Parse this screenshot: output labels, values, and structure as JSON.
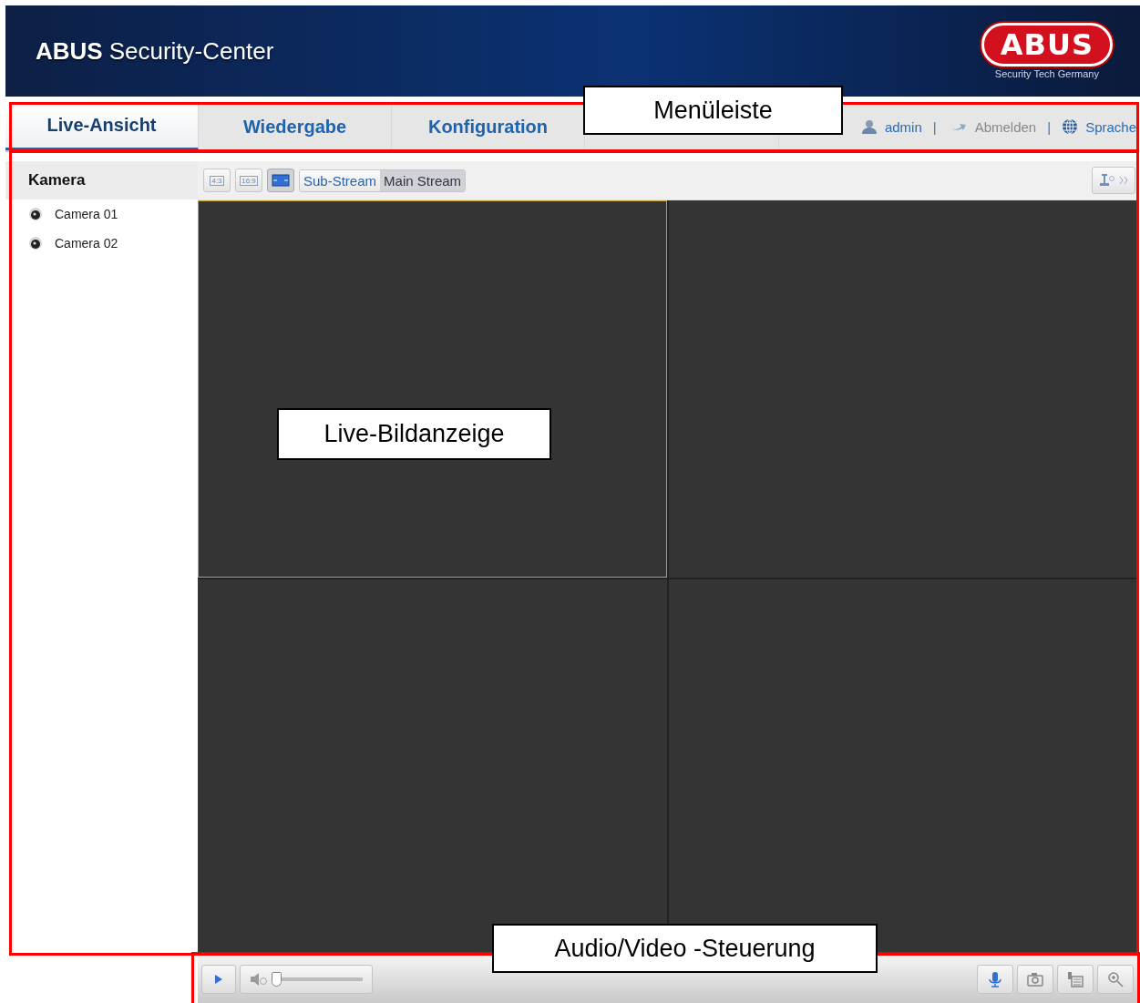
{
  "header": {
    "title_bold": "ABUS",
    "title": "Security-Center",
    "logo": "ABUS",
    "tagline": "Security Tech Germany"
  },
  "tabs": [
    {
      "label": "Live-Ansicht",
      "selected": true
    },
    {
      "label": "Wiedergabe",
      "selected": false
    },
    {
      "label": "Konfiguration",
      "selected": false
    },
    {
      "kind": "hidden",
      "selected": false
    }
  ],
  "user_links": [
    {
      "kind": "user",
      "label": "admin"
    },
    {
      "kind": "separator",
      "label": "|"
    },
    {
      "kind": "logout",
      "label": "Abmelden"
    },
    {
      "kind": "separator",
      "label": "|"
    },
    {
      "kind": "language",
      "label": "Sprache"
    }
  ],
  "sidebar": {
    "title": "Kamera",
    "items": [
      {
        "label": "Camera 01"
      },
      {
        "label": "Camera 02"
      }
    ]
  },
  "view_modes": [
    {
      "kind": "ratio",
      "label": "4:3",
      "selected": false
    },
    {
      "kind": "ratio",
      "label": "16:9",
      "selected": false
    },
    {
      "kind": "fill",
      "selected": true
    }
  ],
  "streams": [
    {
      "label": "Sub-Stream",
      "selected": false
    },
    {
      "label": "Main Stream",
      "selected": true
    }
  ],
  "panes": [
    {
      "selected": true
    },
    {
      "selected": false
    },
    {
      "selected": false
    },
    {
      "selected": false
    }
  ],
  "controls": {
    "volume": {
      "level": 0.0
    },
    "right_buttons": [
      {
        "kind": "mic"
      },
      {
        "kind": "camera"
      },
      {
        "kind": "record"
      },
      {
        "kind": "zoom"
      }
    ]
  },
  "callouts": [
    {
      "label": "Menüleiste"
    },
    {
      "label": "Live-Bildanzeige"
    },
    {
      "label": "Audio/Video -Steuerung"
    }
  ]
}
